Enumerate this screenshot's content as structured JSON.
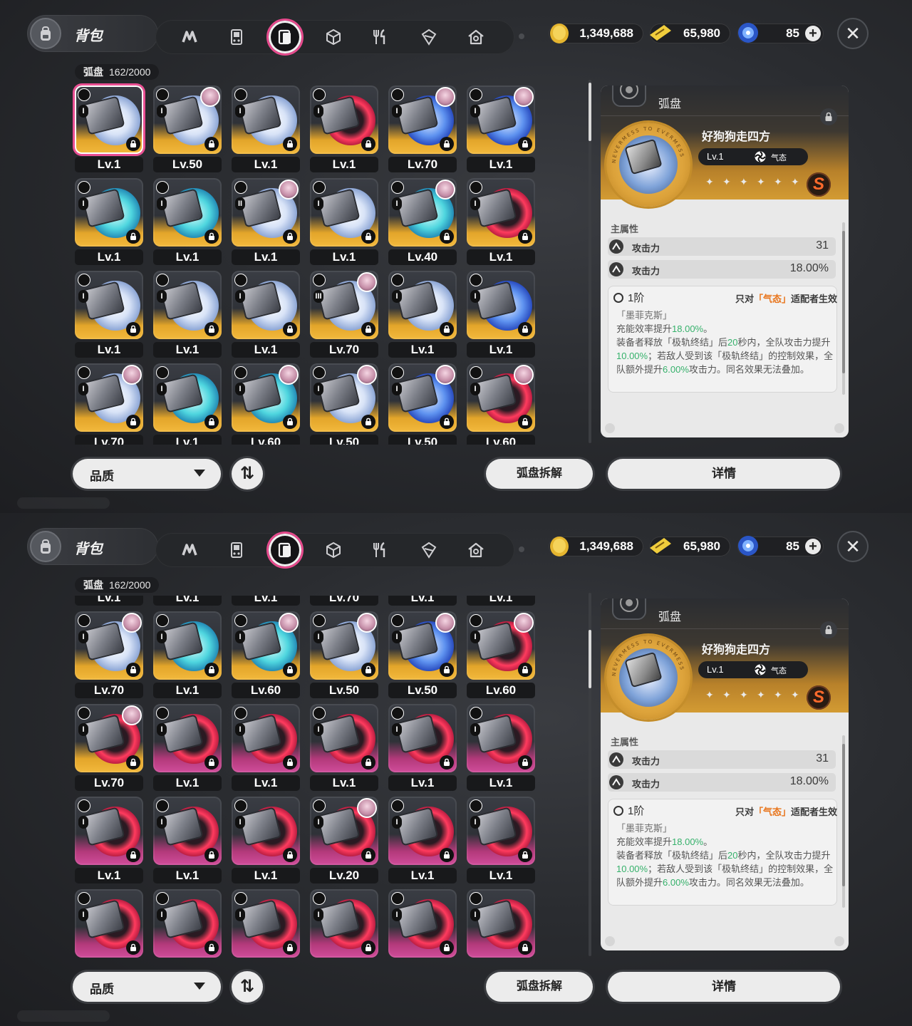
{
  "header": {
    "title": "背包",
    "tabs": [
      "abilities-tab",
      "device-tab",
      "drive-disc-tab",
      "box-tab",
      "food-tab",
      "module-tab",
      "house-tab"
    ],
    "active_tab_index": 2,
    "resources": [
      {
        "name": "coin",
        "value": "1,349,688",
        "color": "#f0c23a"
      },
      {
        "name": "ticket",
        "value": "65,980",
        "color": "#f5d34a"
      },
      {
        "name": "energy",
        "value": "85",
        "color": "#3d7ef2"
      }
    ]
  },
  "inventory": {
    "label": "弧盘",
    "count": "162/2000"
  },
  "top_view": {
    "grid": [
      {
        "tier": "I",
        "level": "Lv.1",
        "selected": true,
        "agent": false,
        "ring": "white"
      },
      {
        "tier": "I",
        "level": "Lv.50",
        "agent": true,
        "ring": "white"
      },
      {
        "tier": "I",
        "level": "Lv.1",
        "agent": false,
        "ring": "white"
      },
      {
        "tier": "I",
        "level": "Lv.1",
        "agent": false,
        "ring": "red"
      },
      {
        "tier": "I",
        "level": "Lv.70",
        "agent": true,
        "ring": "blue"
      },
      {
        "tier": "I",
        "level": "Lv.1",
        "agent": true,
        "ring": "blue"
      },
      {
        "tier": "I",
        "level": "Lv.1",
        "agent": false,
        "ring": "cyan"
      },
      {
        "tier": "I",
        "level": "Lv.1",
        "agent": false,
        "ring": "cyan"
      },
      {
        "tier": "II",
        "level": "Lv.1",
        "agent": true,
        "ring": "white"
      },
      {
        "tier": "I",
        "level": "Lv.1",
        "agent": false,
        "ring": "white"
      },
      {
        "tier": "I",
        "level": "Lv.40",
        "agent": true,
        "ring": "cyan"
      },
      {
        "tier": "I",
        "level": "Lv.1",
        "agent": false,
        "ring": "red"
      },
      {
        "tier": "I",
        "level": "Lv.1",
        "agent": false,
        "ring": "white"
      },
      {
        "tier": "I",
        "level": "Lv.1",
        "agent": false,
        "ring": "white"
      },
      {
        "tier": "I",
        "level": "Lv.1",
        "agent": false,
        "ring": "white"
      },
      {
        "tier": "III",
        "level": "Lv.70",
        "agent": true,
        "ring": "white"
      },
      {
        "tier": "I",
        "level": "Lv.1",
        "agent": false,
        "ring": "white"
      },
      {
        "tier": "I",
        "level": "Lv.1",
        "agent": false,
        "ring": "blue"
      },
      {
        "tier": "I",
        "level": "Lv.70",
        "agent": true,
        "ring": "white"
      },
      {
        "tier": "I",
        "level": "Lv.1",
        "agent": false,
        "ring": "cyan"
      },
      {
        "tier": "I",
        "level": "Lv.60",
        "agent": true,
        "ring": "cyan"
      },
      {
        "tier": "I",
        "level": "Lv.50",
        "agent": true,
        "ring": "white"
      },
      {
        "tier": "I",
        "level": "Lv.50",
        "agent": true,
        "ring": "blue"
      },
      {
        "tier": "I",
        "level": "Lv.60",
        "agent": true,
        "ring": "red"
      }
    ]
  },
  "bottom_view": {
    "grid": [
      {
        "tier": "I",
        "level": "Lv.1",
        "agent": false,
        "ring": "white"
      },
      {
        "tier": "I",
        "level": "Lv.1",
        "agent": false,
        "ring": "white"
      },
      {
        "tier": "I",
        "level": "Lv.1",
        "agent": false,
        "ring": "white"
      },
      {
        "tier": "III",
        "level": "Lv.70",
        "agent": false,
        "ring": "white"
      },
      {
        "tier": "I",
        "level": "Lv.1",
        "agent": false,
        "ring": "white"
      },
      {
        "tier": "I",
        "level": "Lv.1",
        "agent": false,
        "ring": "blue"
      },
      {
        "tier": "I",
        "level": "Lv.70",
        "agent": true,
        "ring": "white"
      },
      {
        "tier": "I",
        "level": "Lv.1",
        "agent": false,
        "ring": "cyan"
      },
      {
        "tier": "I",
        "level": "Lv.60",
        "agent": true,
        "ring": "cyan"
      },
      {
        "tier": "I",
        "level": "Lv.50",
        "agent": true,
        "ring": "white"
      },
      {
        "tier": "I",
        "level": "Lv.50",
        "agent": true,
        "ring": "blue"
      },
      {
        "tier": "I",
        "level": "Lv.60",
        "agent": true,
        "ring": "red"
      },
      {
        "tier": "I",
        "level": "Lv.70",
        "agent": true,
        "ring": "red"
      },
      {
        "tier": "I",
        "level": "Lv.1",
        "agent": false,
        "ring": "red",
        "pink": true
      },
      {
        "tier": "I",
        "level": "Lv.1",
        "agent": false,
        "ring": "red",
        "pink": true
      },
      {
        "tier": "I",
        "level": "Lv.1",
        "agent": false,
        "ring": "red",
        "pink": true
      },
      {
        "tier": "I",
        "level": "Lv.1",
        "agent": false,
        "ring": "red",
        "pink": true
      },
      {
        "tier": "I",
        "level": "Lv.1",
        "agent": false,
        "ring": "red",
        "pink": true
      },
      {
        "tier": "I",
        "level": "Lv.1",
        "agent": false,
        "ring": "red",
        "pink": true
      },
      {
        "tier": "I",
        "level": "Lv.1",
        "agent": false,
        "ring": "red",
        "pink": true
      },
      {
        "tier": "I",
        "level": "Lv.1",
        "agent": false,
        "ring": "red",
        "pink": true
      },
      {
        "tier": "I",
        "level": "Lv.20",
        "agent": true,
        "ring": "red",
        "pink": true
      },
      {
        "tier": "I",
        "level": "Lv.1",
        "agent": false,
        "ring": "red",
        "pink": true
      },
      {
        "tier": "I",
        "level": "Lv.1",
        "agent": false,
        "ring": "red",
        "pink": true
      },
      {
        "tier": "I",
        "level": "",
        "agent": false,
        "ring": "red",
        "pink": true
      },
      {
        "tier": "I",
        "level": "",
        "agent": false,
        "ring": "red",
        "pink": true
      },
      {
        "tier": "I",
        "level": "",
        "agent": false,
        "ring": "red",
        "pink": true
      },
      {
        "tier": "I",
        "level": "",
        "agent": false,
        "ring": "red",
        "pink": true
      },
      {
        "tier": "I",
        "level": "",
        "agent": false,
        "ring": "red",
        "pink": true
      },
      {
        "tier": "I",
        "level": "",
        "agent": false,
        "ring": "red",
        "pink": true
      }
    ]
  },
  "detail": {
    "category": "弧盘",
    "name": "好狗狗走四方",
    "level": "Lv.1",
    "attribute": "气态",
    "rank": "S",
    "stars": 6,
    "main_attr_title": "主属性",
    "stats": [
      {
        "name": "攻击力",
        "value": "31"
      },
      {
        "name": "攻击力",
        "value": "18.00%"
      }
    ],
    "effect_tier": "1阶",
    "effect_condition_pre": "只对",
    "effect_condition_hl": "「气态」",
    "effect_condition_post": "适配者生效",
    "effect_source": "「墨菲克斯」",
    "effect_l1a": "充能效率提升",
    "effect_l1b": "18.00%",
    "effect_l1c": "。",
    "effect_l2a": "装备者释放「极轨终结」后",
    "effect_l2b": "20",
    "effect_l2c": "秒内，全队攻击力提升",
    "effect_l2d": "10.00%",
    "effect_l2e": "；若敌人受到该「极轨终结」的控制效果，全队额外提升",
    "effect_l2f": "6.00%",
    "effect_l2g": "攻击力。同名效果无法叠加。",
    "medal_text": "NEVERMESS TO EVERMESS"
  },
  "buttons": {
    "quality": "品质",
    "sort": "⇅",
    "disassemble": "弧盘拆解",
    "details": "详情"
  }
}
